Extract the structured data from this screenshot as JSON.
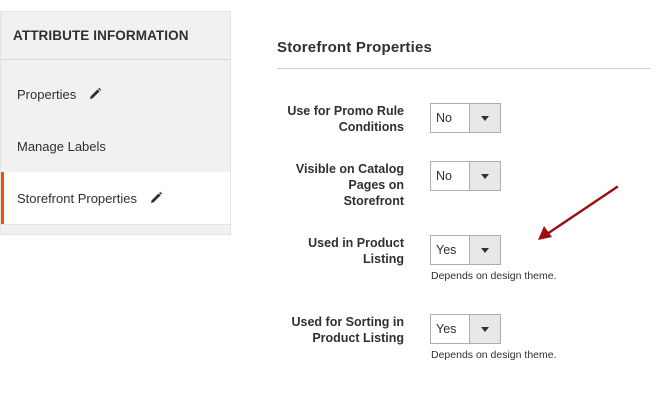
{
  "sidebar": {
    "title": "ATTRIBUTE INFORMATION",
    "items": [
      {
        "label": "Properties",
        "icon": "pencil-icon"
      },
      {
        "label": "Manage Labels"
      },
      {
        "label": "Storefront Properties",
        "icon": "pencil-icon",
        "active": true
      }
    ]
  },
  "main": {
    "section_title": "Storefront Properties",
    "fields": [
      {
        "label_lines": [
          "Use for Promo Rule",
          "Conditions"
        ],
        "value": "No"
      },
      {
        "label_lines": [
          "Visible on Catalog",
          "Pages on",
          "Storefront"
        ],
        "value": "No"
      },
      {
        "label_lines": [
          "Used in Product",
          "Listing"
        ],
        "value": "Yes",
        "note": "Depends on design theme."
      },
      {
        "label_lines": [
          "Used for Sorting in",
          "Product Listing"
        ],
        "value": "Yes",
        "note": "Depends on design theme."
      }
    ]
  },
  "colors": {
    "accent": "#eb5202",
    "annotation_arrow": "#9b1111"
  }
}
